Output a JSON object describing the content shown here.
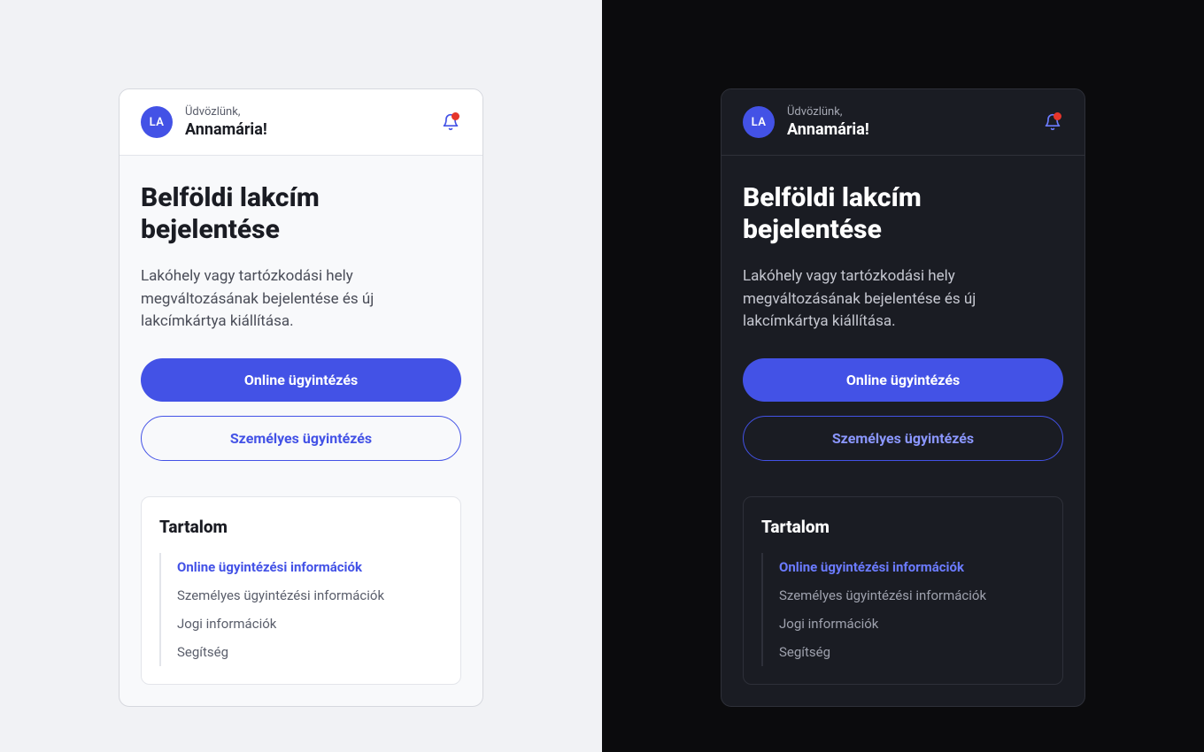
{
  "header": {
    "avatar_initials": "LA",
    "welcome": "Üdvözlünk,",
    "username": "Annamária!"
  },
  "page": {
    "title": "Belföldi lakcím bejelentése",
    "description": "Lakóhely vagy tartózkodási hely megváltozásának bejelentése és új lakcímkártya kiállítása.",
    "primary_button": "Online ügyintézés",
    "secondary_button": "Személyes ügyintézés"
  },
  "toc": {
    "heading": "Tartalom",
    "items": [
      "Online ügyintézési információk",
      "Személyes ügyintézési információk",
      "Jogi információk",
      "Segítség"
    ],
    "active_index": 0
  },
  "colors": {
    "accent": "#4352e6",
    "notification_dot": "#e5352b"
  }
}
